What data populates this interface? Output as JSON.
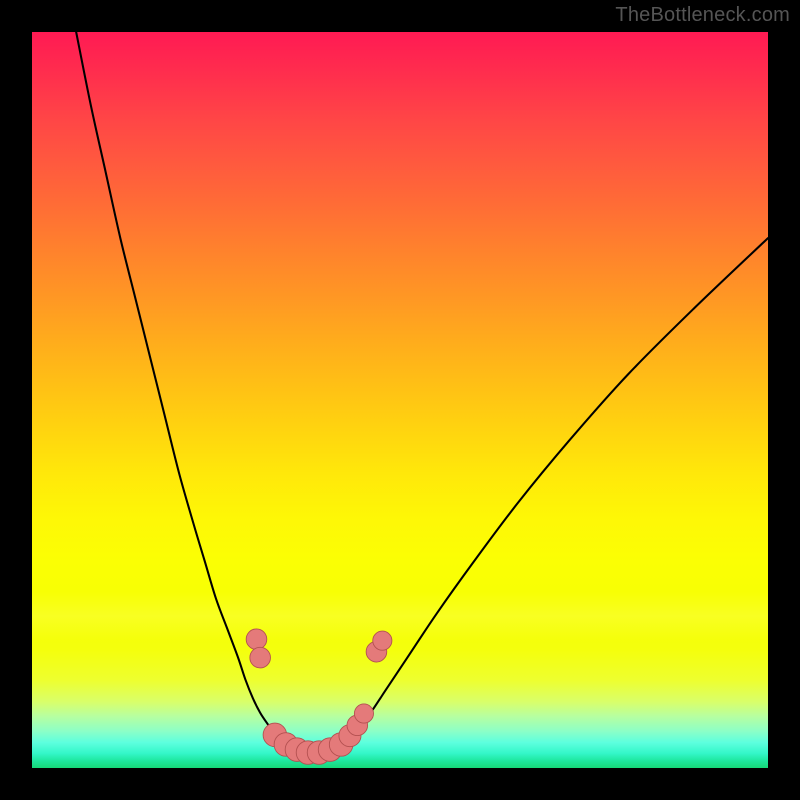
{
  "watermark": "TheBottleneck.com",
  "colors": {
    "frame": "#000000",
    "curve": "#000000",
    "marker_fill": "#e47a7a",
    "marker_stroke": "#b35050"
  },
  "chart_data": {
    "type": "line",
    "title": "",
    "xlabel": "",
    "ylabel": "",
    "xlim": [
      0,
      100
    ],
    "ylim": [
      0,
      100
    ],
    "note": "Approximate V-shaped bottleneck curve; x in percent of plot width, y in percent of plot height (0 at top).",
    "series": [
      {
        "name": "left-branch",
        "x": [
          6,
          8,
          10,
          12,
          14,
          16,
          18,
          20,
          22,
          23.5,
          25,
          26.5,
          28,
          29,
          30,
          31,
          32,
          33,
          34,
          35
        ],
        "y": [
          0,
          10,
          19,
          28,
          36,
          44,
          52,
          60,
          67,
          72,
          77,
          81,
          85,
          88,
          90.5,
          92.5,
          94,
          95.3,
          96.3,
          97
        ]
      },
      {
        "name": "bottom",
        "x": [
          35,
          36,
          37,
          38,
          39,
          40,
          41,
          42
        ],
        "y": [
          97,
          97.6,
          97.9,
          98,
          98,
          97.9,
          97.6,
          97
        ]
      },
      {
        "name": "right-branch",
        "x": [
          42,
          44,
          46,
          48,
          51,
          55,
          60,
          66,
          73,
          81,
          90,
          100
        ],
        "y": [
          97,
          95,
          92.5,
          89.5,
          85,
          79,
          72,
          64,
          55.5,
          46.5,
          37.5,
          28
        ]
      }
    ],
    "markers": {
      "name": "highlight-dots",
      "note": "Coral dots clustered near the bottom of the V",
      "points": [
        {
          "x": 30.5,
          "y": 82.5,
          "r": 1.4
        },
        {
          "x": 31.0,
          "y": 85.0,
          "r": 1.4
        },
        {
          "x": 33.0,
          "y": 95.5,
          "r": 1.6
        },
        {
          "x": 34.5,
          "y": 96.8,
          "r": 1.6
        },
        {
          "x": 36.0,
          "y": 97.5,
          "r": 1.6
        },
        {
          "x": 37.5,
          "y": 97.9,
          "r": 1.6
        },
        {
          "x": 39.0,
          "y": 97.9,
          "r": 1.6
        },
        {
          "x": 40.5,
          "y": 97.5,
          "r": 1.6
        },
        {
          "x": 42.0,
          "y": 96.8,
          "r": 1.6
        },
        {
          "x": 43.2,
          "y": 95.6,
          "r": 1.5
        },
        {
          "x": 44.2,
          "y": 94.2,
          "r": 1.4
        },
        {
          "x": 45.1,
          "y": 92.6,
          "r": 1.3
        },
        {
          "x": 46.8,
          "y": 84.2,
          "r": 1.4
        },
        {
          "x": 47.6,
          "y": 82.7,
          "r": 1.3
        }
      ]
    }
  }
}
